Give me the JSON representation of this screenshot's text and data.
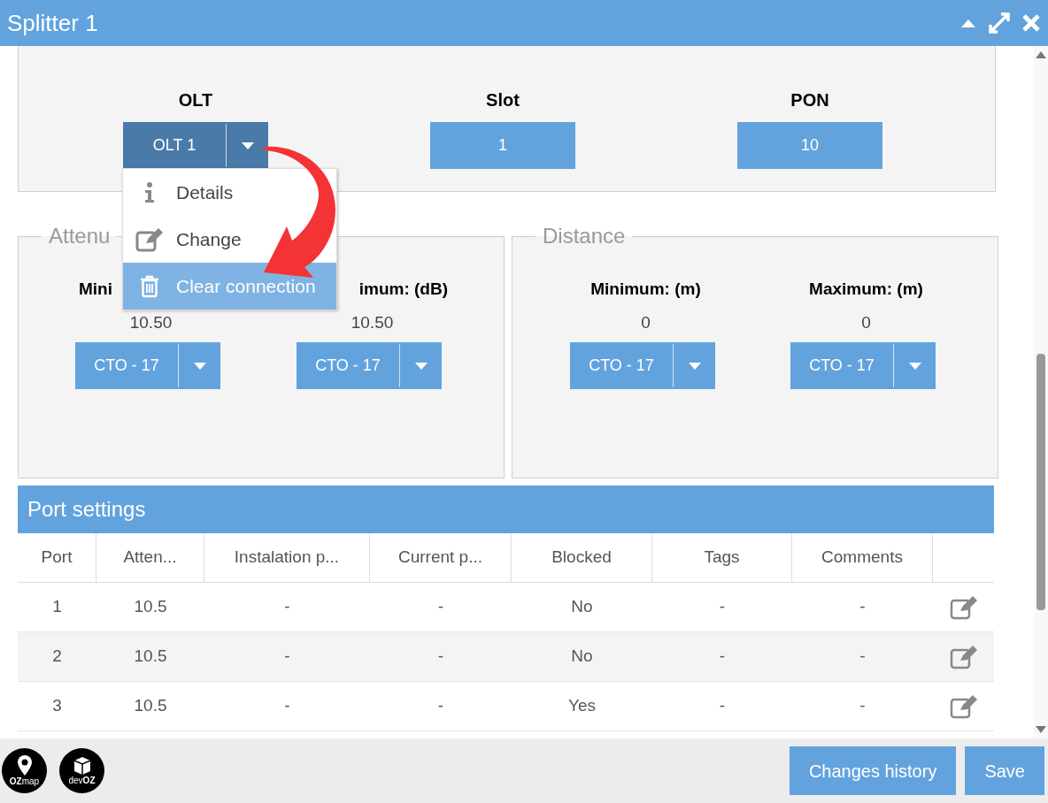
{
  "window": {
    "title": "Splitter 1"
  },
  "connection": {
    "columns": [
      {
        "label": "OLT",
        "value": "OLT 1",
        "kind": "split",
        "expanded": true
      },
      {
        "label": "Slot",
        "value": "1",
        "kind": "plain"
      },
      {
        "label": "PON",
        "value": "10",
        "kind": "plain"
      }
    ]
  },
  "menu": {
    "items": [
      {
        "label": "Details",
        "kind": "info",
        "selected": false
      },
      {
        "label": "Change",
        "kind": "edit",
        "selected": false
      },
      {
        "label": "Clear connection",
        "kind": "trash",
        "selected": true
      }
    ]
  },
  "attenuation": {
    "legend": "Attenu",
    "fields": [
      {
        "label": "Mini",
        "value": "10.50",
        "select": "CTO - 17"
      },
      {
        "label": "imum: (dB)",
        "value": "10.50",
        "select": "CTO - 17"
      }
    ]
  },
  "distance": {
    "legend": "Distance",
    "fields": [
      {
        "label": "Minimum: (m)",
        "value": "0",
        "select": "CTO - 17"
      },
      {
        "label": "Maximum: (m)",
        "value": "0",
        "select": "CTO - 17"
      }
    ]
  },
  "port_settings": {
    "title": "Port settings",
    "columns": [
      "Port",
      "Atten...",
      "Instalation p...",
      "Current p...",
      "Blocked",
      "Tags",
      "Comments"
    ],
    "rows": [
      {
        "cells": [
          "1",
          "10.5",
          "-",
          "-",
          "No",
          "-",
          "-"
        ]
      },
      {
        "cells": [
          "2",
          "10.5",
          "-",
          "-",
          "No",
          "-",
          "-"
        ]
      },
      {
        "cells": [
          "3",
          "10.5",
          "-",
          "-",
          "Yes",
          "-",
          "-"
        ]
      }
    ]
  },
  "footer": {
    "logos": [
      "**OZ**map",
      "dev**OZ**"
    ],
    "buttons": [
      "Changes history",
      "Save"
    ]
  }
}
